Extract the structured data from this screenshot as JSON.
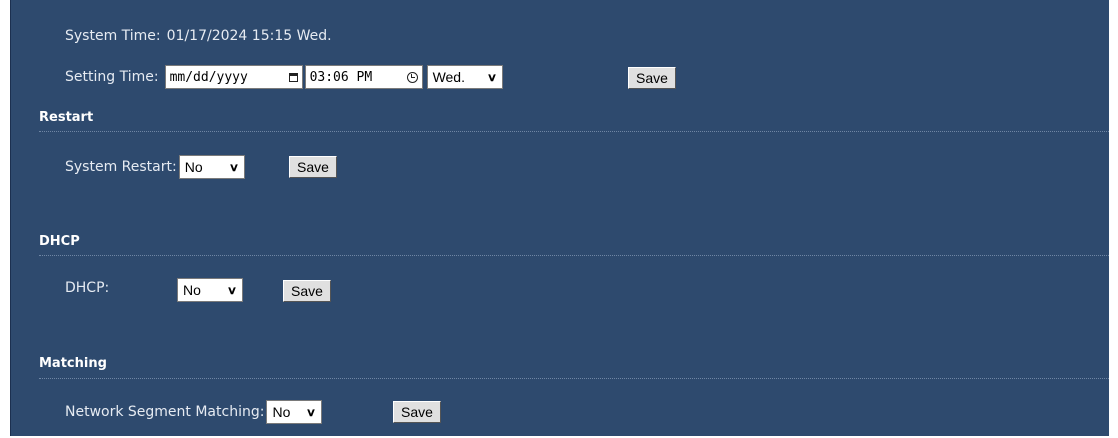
{
  "system_time": {
    "label": "System Time:",
    "value": "01/17/2024 15:15 Wed."
  },
  "setting_time": {
    "label": "Setting Time:",
    "date_placeholder": "mm/dd/yyyy",
    "time_value": "03:06 PM",
    "weekday_selected": "Wed.",
    "save_label": "Save"
  },
  "restart": {
    "title": "Restart",
    "label": "System Restart:",
    "selected": "No",
    "save_label": "Save"
  },
  "dhcp": {
    "title": "DHCP",
    "label": "DHCP:",
    "selected": "No",
    "save_label": "Save"
  },
  "matching": {
    "title": "Matching",
    "label": "Network Segment Matching:",
    "selected": "No",
    "save_label": "Save"
  },
  "colors": {
    "panel_background": "#2e4a6e",
    "text": "#e6ebf2",
    "section_title": "#ffffff"
  }
}
